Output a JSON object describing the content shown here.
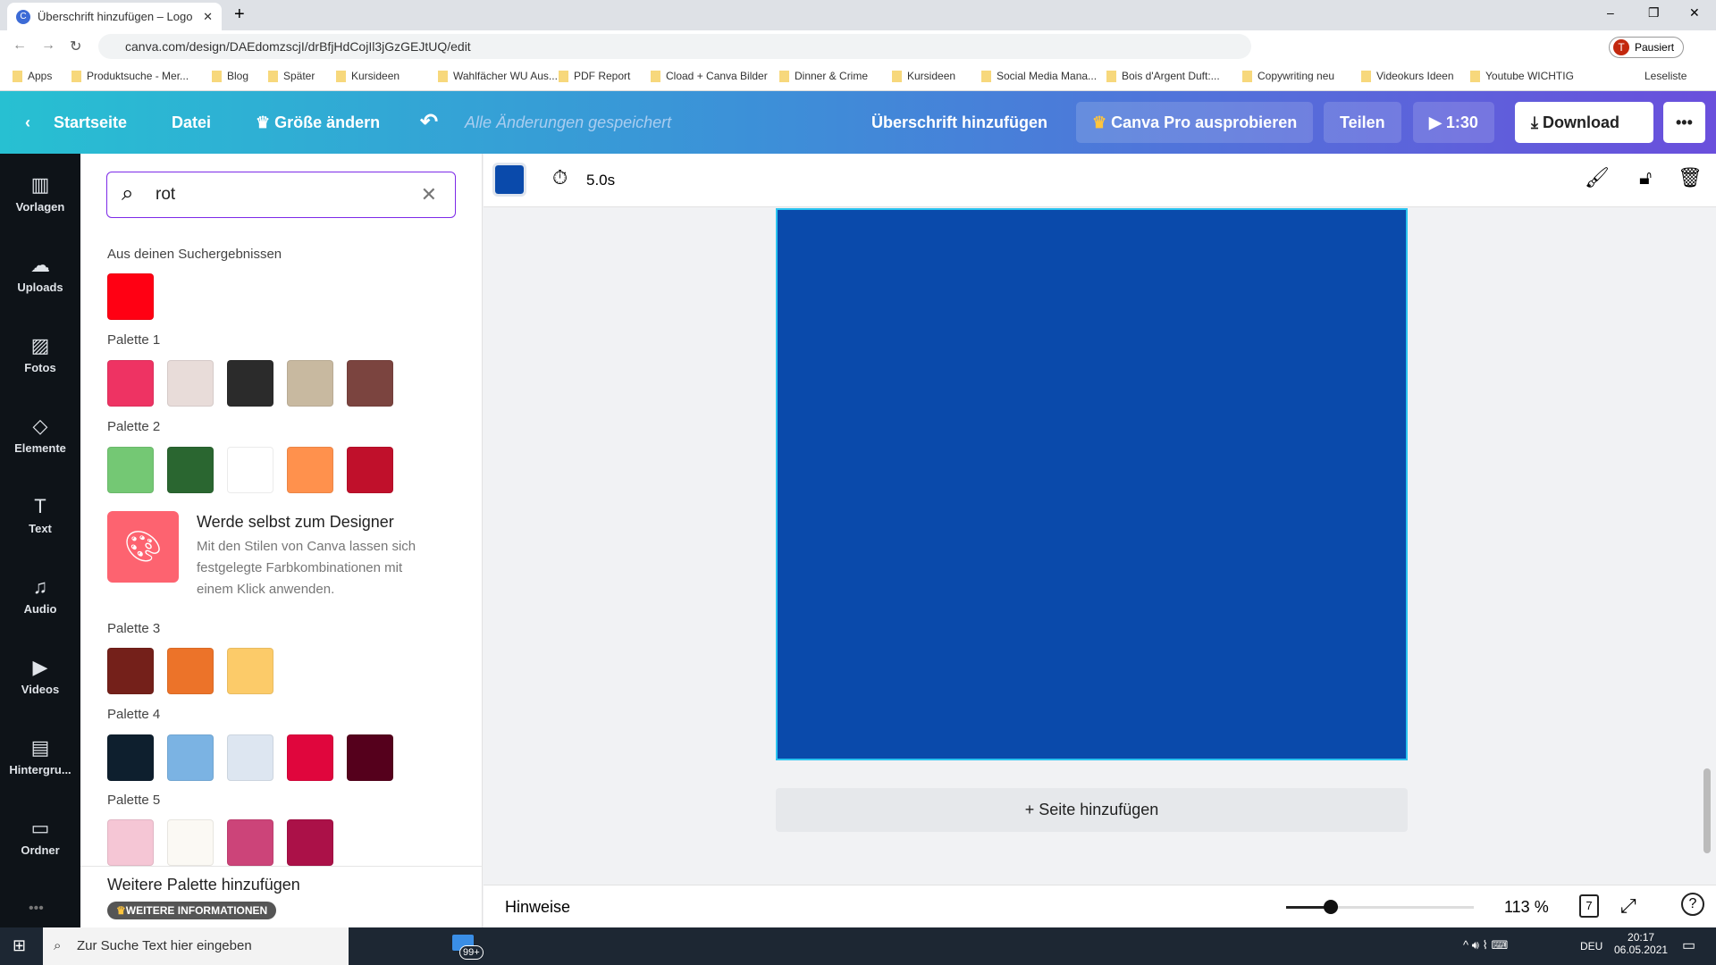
{
  "browser": {
    "tab_title": "Überschrift hinzufügen – Logo",
    "url": "canva.com/design/DAEdomzscjI/drBfjHdCojIl3jGzGEJtUQ/edit",
    "profile": "Pausiert",
    "bookmarks": [
      "Apps",
      "Produktsuche - Mer...",
      "Blog",
      "Später",
      "Kursideen",
      "Wahlfächer WU Aus...",
      "PDF Report",
      "Cload + Canva Bilder",
      "Dinner & Crime",
      "Kursideen",
      "Social Media Mana...",
      "Bois d'Argent Duft:...",
      "Copywriting neu",
      "Videokurs Ideen",
      "Youtube WICHTIG"
    ],
    "reading_list": "Leseliste"
  },
  "header": {
    "home": "Startseite",
    "file": "Datei",
    "resize": "Größe ändern",
    "saved": "Alle Änderungen gespeichert",
    "title": "Überschrift hinzufügen",
    "pro": "Canva Pro ausprobieren",
    "share": "Teilen",
    "play_time": "1:30",
    "download": "Download"
  },
  "sidebar": [
    {
      "label": "Vorlagen",
      "icon": "▥"
    },
    {
      "label": "Uploads",
      "icon": "☁"
    },
    {
      "label": "Fotos",
      "icon": "▨"
    },
    {
      "label": "Elemente",
      "icon": "◇"
    },
    {
      "label": "Text",
      "icon": "T"
    },
    {
      "label": "Audio",
      "icon": "♫"
    },
    {
      "label": "Videos",
      "icon": "▶"
    },
    {
      "label": "Hintergru...",
      "icon": "▤"
    },
    {
      "label": "Ordner",
      "icon": "▭"
    }
  ],
  "panel": {
    "search_value": "rot",
    "results_label": "Aus deinen Suchergebnissen",
    "results_colors": [
      "#ff0013"
    ],
    "palettes": [
      {
        "name": "Palette 1",
        "colors": [
          "#ee3363",
          "#e8dcd9",
          "#2b2b2b",
          "#c8b9a0",
          "#7b443f"
        ]
      },
      {
        "name": "Palette 2",
        "colors": [
          "#74c874",
          "#2a6630",
          "#ffffff",
          "#ff914d",
          "#c0102b"
        ]
      },
      {
        "name": "Palette 3",
        "colors": [
          "#74201a",
          "#ec7329",
          "#fccb69"
        ]
      },
      {
        "name": "Palette 4",
        "colors": [
          "#0e1f2e",
          "#7bb3e3",
          "#dde6f1",
          "#e0063d",
          "#55001c"
        ]
      },
      {
        "name": "Palette 5",
        "colors": [
          "#f5c6d5",
          "#fbf9f4",
          "#cc4479",
          "#ab1148"
        ]
      }
    ],
    "promo": {
      "title": "Werde selbst zum Designer",
      "text": "Mit den Stilen von Canva lassen sich festgelegte Farbkombinationen mit einem Klick anwenden."
    },
    "add_palette": "Weitere Palette hinzufügen",
    "more_info": "WEITERE INFORMATIONEN"
  },
  "toolbar": {
    "color": "#0a4aab",
    "duration": "5.0s"
  },
  "canvas": {
    "background": "#0a4aab",
    "add_page": "+ Seite hinzufügen"
  },
  "bottom": {
    "notes": "Hinweise",
    "zoom": "113 %",
    "pages": "7",
    "zoom_level_percent": 113
  },
  "taskbar": {
    "search_placeholder": "Zur Suche Text hier eingeben",
    "lang": "DEU",
    "time": "20:17",
    "date": "06.05.2021",
    "mail_badge": "99+"
  }
}
